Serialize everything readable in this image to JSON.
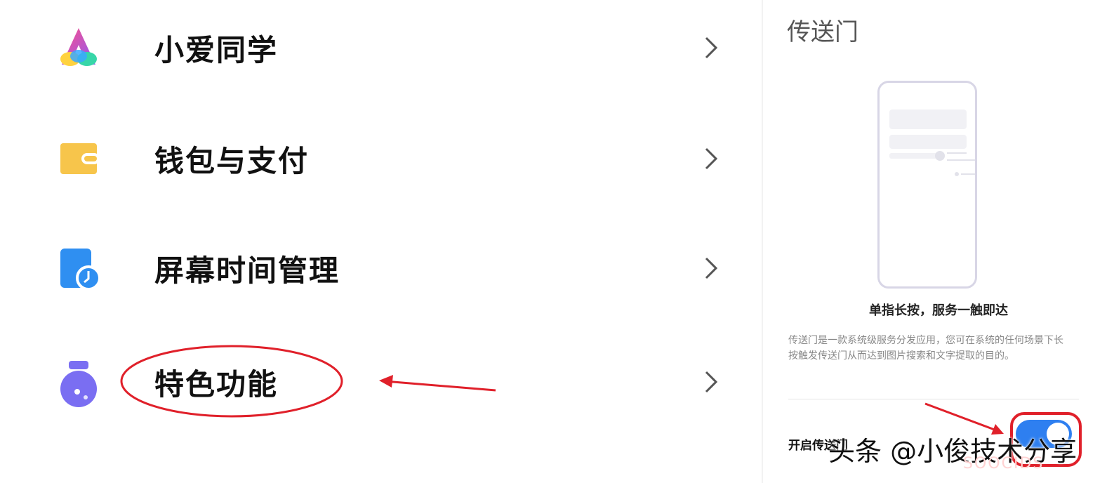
{
  "settings": {
    "items": [
      {
        "label": "小爱同学",
        "icon": "xiaoai-icon"
      },
      {
        "label": "钱包与支付",
        "icon": "wallet-icon"
      },
      {
        "label": "屏幕时间管理",
        "icon": "screen-time-icon"
      },
      {
        "label": "特色功能",
        "icon": "features-flask-icon"
      }
    ]
  },
  "portal": {
    "title": "传送门",
    "heading": "单指长按，服务一触即达",
    "description": "传送门是一款系统级服务分发应用，您可在系统的任何场景下长按触发传送门从而达到图片搜索和文字提取的目的。",
    "enable_label": "开启传送门",
    "toggle_on": true
  },
  "watermark": {
    "text": "头条 @小俊技术分享",
    "faint_text": "SOOCIDS"
  },
  "colors": {
    "annotation_red": "#e0202a",
    "toggle_blue": "#2e7ff0",
    "wallet_yellow": "#f7c54b",
    "screen_time_blue": "#2f8ff1",
    "features_purple": "#7a6ef2"
  }
}
